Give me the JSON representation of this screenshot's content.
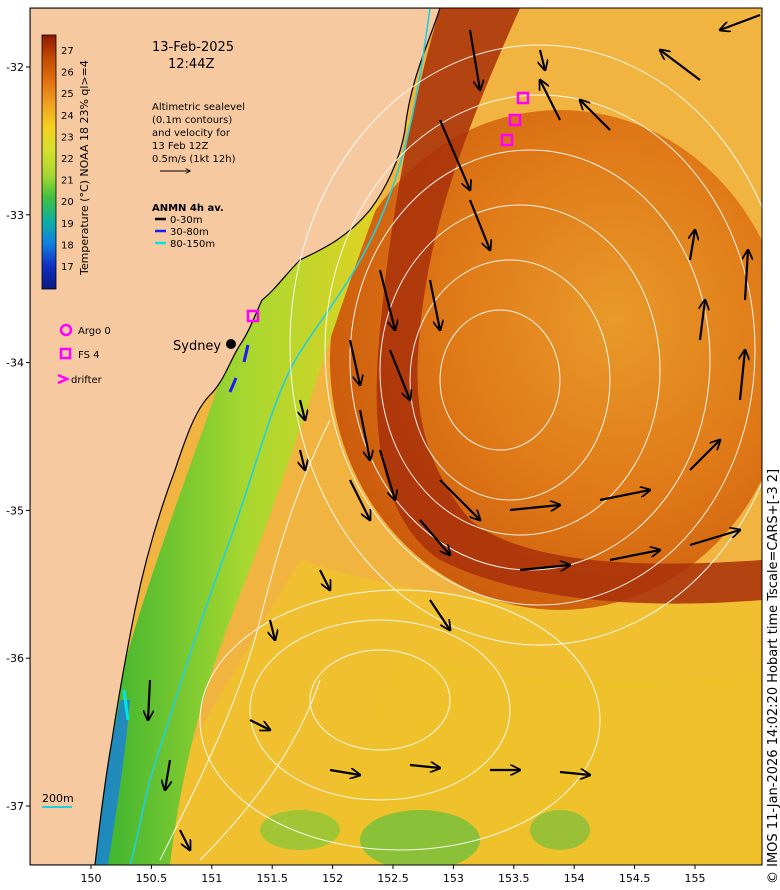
{
  "map": {
    "date": "13-Feb-2025",
    "time": "12:44Z",
    "altimetry_lines": [
      "Altimetric sealevel",
      "(0.1m contours)",
      "and velocity for",
      "13 Feb 12Z",
      "0.5m/s (1kt 12h)"
    ],
    "anmn_title": "ANMN 4h av.",
    "anmn_items": [
      {
        "label": "0-30m",
        "color": "#000000"
      },
      {
        "label": "30-80m",
        "color": "#1a1aff"
      },
      {
        "label": "80-150m",
        "color": "#00e5e5"
      }
    ],
    "city_label": "Sydney",
    "platform_legend": [
      {
        "label": "Argo 0",
        "symbol": "circle",
        "color": "#ff00ff"
      },
      {
        "label": "FS 4",
        "symbol": "square",
        "color": "#ff00ff"
      },
      {
        "label": "drifter",
        "symbol": "chevron",
        "color": "#ff00ff"
      }
    ],
    "depth_label": "200m",
    "colorbar": {
      "label": "Temperature (°C) NOAA 18 23% ql>=4",
      "ticks": [
        "27",
        "26",
        "25",
        "24",
        "23",
        "22",
        "21",
        "20",
        "19",
        "18",
        "17"
      ],
      "colors": [
        "#8b1a00",
        "#c24a00",
        "#e07010",
        "#f0a020",
        "#f5d020",
        "#d8e030",
        "#a8d830",
        "#40c040",
        "#10b0a0",
        "#1080e0",
        "#1030c0",
        "#0a1a80"
      ]
    },
    "x_ticks": [
      "150",
      "150.5",
      "151",
      "151.5",
      "152",
      "152.5",
      "153",
      "153.5",
      "154",
      "154.5",
      "155"
    ],
    "y_ticks": [
      "-32",
      "-33",
      "-34",
      "-35",
      "-36",
      "-37"
    ],
    "credit": "© IMOS 11-Jan-2026 14:02:20 Hobart time Tscale=CARS+[-3 2]",
    "colors": {
      "land": "#f7c9a0",
      "coast": "#000000",
      "contour": "#ffffff",
      "vector": "#000000",
      "platform": "#ff00ff"
    }
  }
}
